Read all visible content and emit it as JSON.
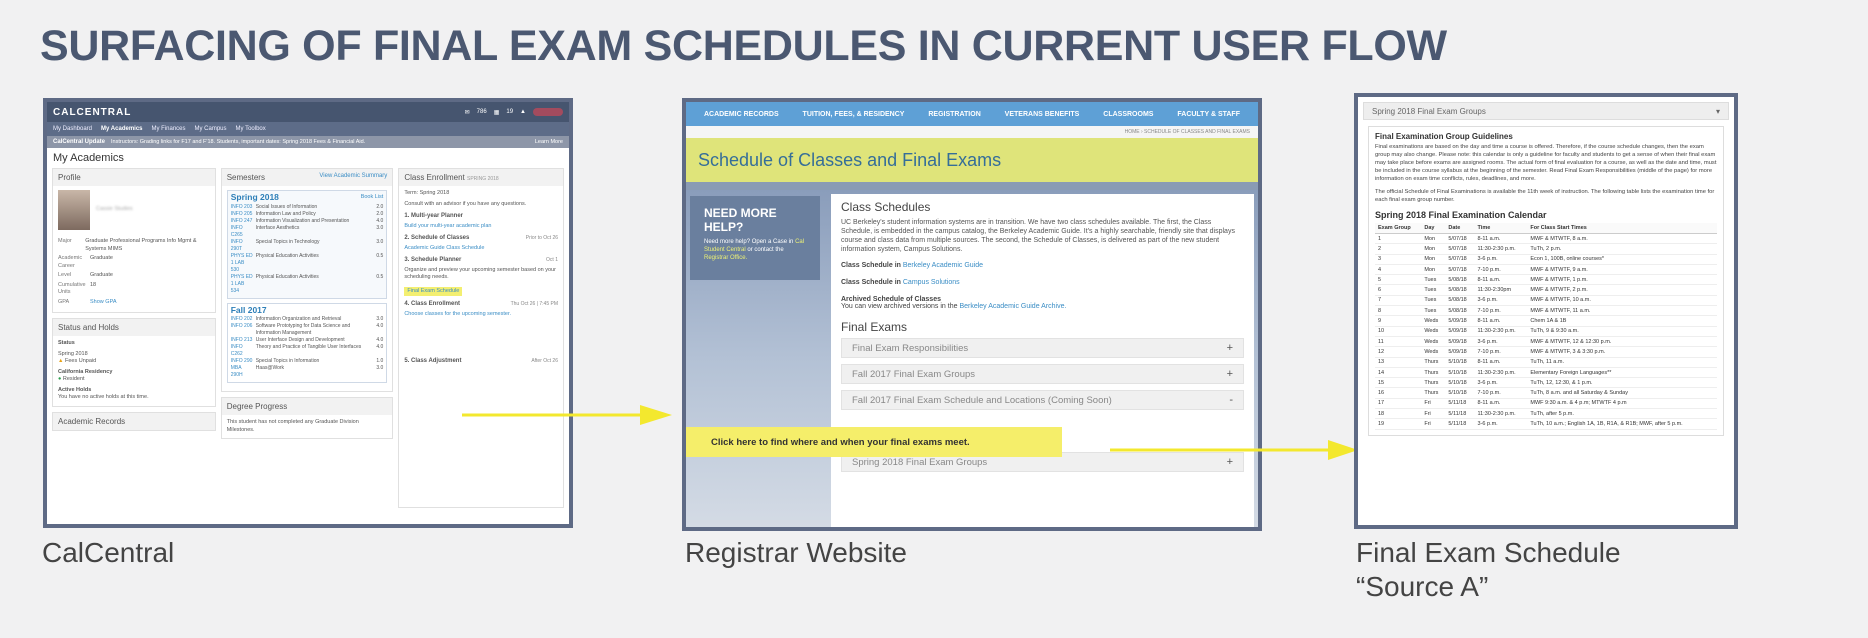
{
  "title": "SURFACING OF FINAL EXAM SCHEDULES IN CURRENT USER FLOW",
  "captions": {
    "calcentral": "CalCentral",
    "registrar": "Registrar Website",
    "source_a_line1": "Final Exam Schedule",
    "source_a_line2": "“Source A”"
  },
  "colors": {
    "title": "#4b5871",
    "frame": "#5e6a85",
    "highlight": "#f3ef71"
  },
  "calcentral": {
    "logo": "CALCENTRAL",
    "badges": {
      "mail": "786",
      "cal": "19"
    },
    "nav": [
      "My Dashboard",
      "My Academics",
      "My Finances",
      "My Campus",
      "My Toolbox"
    ],
    "update_label": "CalCentral Update",
    "update_text": "Instructors: Grading links for F17 and F'18. Students, important dates: Spring 2018 Fees & Financial Aid.",
    "learn_more": "Learn More",
    "heading": "My Academics",
    "profile": {
      "title": "Profile",
      "name": "Cassie Studies",
      "rows": [
        {
          "k": "Major",
          "v": "Graduate Professional Programs Info Mgmt & Systems MIMS"
        },
        {
          "k": "Academic Career",
          "v": "Graduate"
        },
        {
          "k": "Level",
          "v": "Graduate"
        },
        {
          "k": "Cumulative Units",
          "v": "18"
        },
        {
          "k": "GPA",
          "v": "Show GPA"
        }
      ]
    },
    "status": {
      "title": "Status and Holds",
      "status_label": "Status",
      "term": "Spring 2018",
      "fees": "Fees Unpaid",
      "residency_label": "California Residency",
      "residency": "Resident",
      "holds_label": "Active Holds",
      "holds": "You have no active holds at this time."
    },
    "records": "Academic Records",
    "semesters": {
      "title": "Semesters",
      "link": "View Academic Summary",
      "spring": {
        "name": "Spring 2018",
        "book": "Book List",
        "courses": [
          {
            "c": "INFO 203",
            "t": "Social Issues of Information",
            "u": "2.0"
          },
          {
            "c": "INFO 205",
            "t": "Information Law and Policy",
            "u": "2.0"
          },
          {
            "c": "INFO 247",
            "t": "Information Visualization and Presentation",
            "u": "4.0"
          },
          {
            "c": "INFO C265",
            "t": "Interface Aesthetics",
            "u": "3.0"
          },
          {
            "c": "INFO 290T",
            "t": "Special Topics in Technology",
            "u": "3.0"
          },
          {
            "c": "PHYS ED 1 LAB 530",
            "t": "Physical Education Activities",
            "u": "0.5"
          },
          {
            "c": "PHYS ED 1 LAB 534",
            "t": "Physical Education Activities",
            "u": "0.5"
          }
        ]
      },
      "fall": {
        "name": "Fall 2017",
        "courses": [
          {
            "c": "INFO 202",
            "t": "Information Organization and Retrieval",
            "u": "3.0"
          },
          {
            "c": "INFO 206",
            "t": "Software Prototyping for Data Science and Information Management",
            "u": "4.0"
          },
          {
            "c": "INFO 213",
            "t": "User Interface Design and Development",
            "u": "4.0"
          },
          {
            "c": "INFO C262",
            "t": "Theory and Practice of Tangible User Interfaces",
            "u": "4.0"
          },
          {
            "c": "INFO 290",
            "t": "Special Topics in Information",
            "u": "1.0"
          },
          {
            "c": "MBA 290H",
            "t": "Haas@Work",
            "u": "3.0"
          }
        ]
      }
    },
    "degree": {
      "title": "Degree Progress",
      "text": "This student has not completed any Graduate Division Milestones."
    },
    "enrollment": {
      "title": "Class Enrollment",
      "term_tag": "SPRING 2018",
      "term": "Term: Spring 2018",
      "consult": "Consult with an advisor if you have any questions.",
      "steps": [
        {
          "n": "1. Multi-year Planner",
          "d": "",
          "t": "Build your multi-year academic plan"
        },
        {
          "n": "2. Schedule of Classes",
          "d": "Prior to Oct 26",
          "t": "Academic Guide Class Schedule"
        },
        {
          "n": "3. Schedule Planner",
          "d": "Oct 1",
          "t": "Organize and preview your upcoming semester based on your scheduling needs."
        },
        {
          "n": "4. Class Enrollment",
          "d": "Thu Oct 26 | 7:45 PM",
          "t": "Choose classes for the upcoming semester."
        },
        {
          "n": "5. Class Adjustment",
          "d": "After Oct 26",
          "t": ""
        }
      ],
      "final_exam_link": "Final Exam Schedule"
    }
  },
  "registrar": {
    "nav": [
      "ACADEMIC RECORDS",
      "TUITION, FEES, & RESIDENCY",
      "REGISTRATION",
      "VETERANS BENEFITS",
      "CLASSROOMS",
      "FACULTY & STAFF"
    ],
    "breadcrumb": "HOME › SCHEDULE OF CLASSES AND FINAL EXAMS",
    "page_title": "Schedule of Classes and Final Exams",
    "help_title": "NEED MORE HELP?",
    "help_text": "Need more help? Open a Case in",
    "help_link": "Cal Student Central",
    "help_text2": "or contact the",
    "help_link2": "Registrar Office.",
    "section1": "Class Schedules",
    "section1_text": "UC Berkeley's student information systems are in transition. We have two class schedules available. The first, the Class Schedule, is embedded in the campus catalog, the Berkeley Academic Guide. It's a highly searchable, friendly site that displays course and class data from multiple sources. The second, the Schedule of Classes, is delivered as part of the new student information system, Campus Solutions.",
    "item1_a": "Class Schedule in",
    "item1_b": "Berkeley Academic Guide",
    "item2_a": "Class Schedule in",
    "item2_b": "Campus Solutions",
    "item3_title": "Archived Schedule of Classes",
    "item3_text": "You can view archived versions in the",
    "item3_link": "Berkeley Academic Guide Archive.",
    "section2": "Final Exams",
    "accordion": [
      {
        "label": "Final Exam Responsibilities",
        "sym": "+"
      },
      {
        "label": "Fall 2017 Final Exam Groups",
        "sym": "+"
      },
      {
        "label": "Fall 2017 Final Exam Schedule and Locations (Coming Soon)",
        "sym": "-"
      },
      {
        "label": "Spring 2018 Final Exam Groups",
        "sym": "+"
      }
    ],
    "cta": "Click here to find where and when your final exams meet."
  },
  "source_a": {
    "dropdown": "Spring 2018 Final Exam Groups",
    "guidelines_title": "Final Examination Group Guidelines",
    "guidelines_text": "Final examinations are based on the day and time a course is offered. Therefore, if the course schedule changes, then the exam group may also change. Please note: this calendar is only a guideline for faculty and students to get a sense of when their final exam may take place before exams are assigned rooms. The actual form of final evaluation for a course, as well as the date and time, must be included in the course syllabus at the beginning of the semester. Read Final Exam Responsibilities (middle of the page) for more information on exam time conflicts, rules, deadlines, and more.",
    "official_text": "The official Schedule of Final Examinations is available the 11th week of instruction. The following table lists the examination time for each final exam group number.",
    "calendar_title": "Spring 2018 Final Examination Calendar",
    "headers": [
      "Exam Group",
      "Day",
      "Date",
      "Time",
      "For Class Start Times"
    ],
    "rows": [
      [
        "1",
        "Mon",
        "5/07/18",
        "8-11 a.m.",
        "MWF & MTWTF, 8 a.m."
      ],
      [
        "2",
        "Mon",
        "5/07/18",
        "11:30-2:30 p.m.",
        "TuTh, 2 p.m."
      ],
      [
        "3",
        "Mon",
        "5/07/18",
        "3-6 p.m.",
        "Econ 1, 100B, online courses*"
      ],
      [
        "4",
        "Mon",
        "5/07/18",
        "7-10 p.m.",
        "MWF & MTWTF, 9 a.m."
      ],
      [
        "5",
        "Tues",
        "5/08/18",
        "8-11 a.m.",
        "MWF & MTWTF, 1 p.m."
      ],
      [
        "6",
        "Tues",
        "5/08/18",
        "11:30-2:30pm",
        "MWF & MTWTF, 2 p.m."
      ],
      [
        "7",
        "Tues",
        "5/08/18",
        "3-6 p.m.",
        "MWF & MTWTF, 10 a.m."
      ],
      [
        "8",
        "Tues",
        "5/08/18",
        "7-10 p.m.",
        "MWF & MTWTF, 11 a.m."
      ],
      [
        "9",
        "Weds",
        "5/09/18",
        "8-11 a.m.",
        "Chem 1A & 1B"
      ],
      [
        "10",
        "Weds",
        "5/09/18",
        "11:30-2:30 p.m.",
        "TuTh, 9 & 9:30 a.m."
      ],
      [
        "11",
        "Weds",
        "5/09/18",
        "3-6 p.m.",
        "MWF & MTWTF, 12 & 12:30 p.m."
      ],
      [
        "12",
        "Weds",
        "5/09/18",
        "7-10 p.m.",
        "MWF & MTWTF, 3 & 3:30 p.m."
      ],
      [
        "13",
        "Thurs",
        "5/10/18",
        "8-11 a.m.",
        "TuTh, 11 a.m."
      ],
      [
        "14",
        "Thurs",
        "5/10/18",
        "11:30-2:30 p.m.",
        "Elementary Foreign Languages**"
      ],
      [
        "15",
        "Thurs",
        "5/10/18",
        "3-6 p.m.",
        "TuTh, 12, 12:30, & 1 p.m."
      ],
      [
        "16",
        "Thurs",
        "5/10/18",
        "7-10 p.m.",
        "TuTh, 8 a.m. and all Saturday & Sunday"
      ],
      [
        "17",
        "Fri",
        "5/11/18",
        "8-11 a.m.",
        "MWF 9:30 a.m. & 4 p.m; MTWTF 4 p.m"
      ],
      [
        "18",
        "Fri",
        "5/11/18",
        "11:30-2:30 p.m.",
        "TuTh, after 5 p.m."
      ],
      [
        "19",
        "Fri",
        "5/11/18",
        "3-6 p.m.",
        "TuTh, 10 a.m.; English 1A, 1B, R1A, & R1B; MWF, after 5 p.m."
      ]
    ]
  }
}
